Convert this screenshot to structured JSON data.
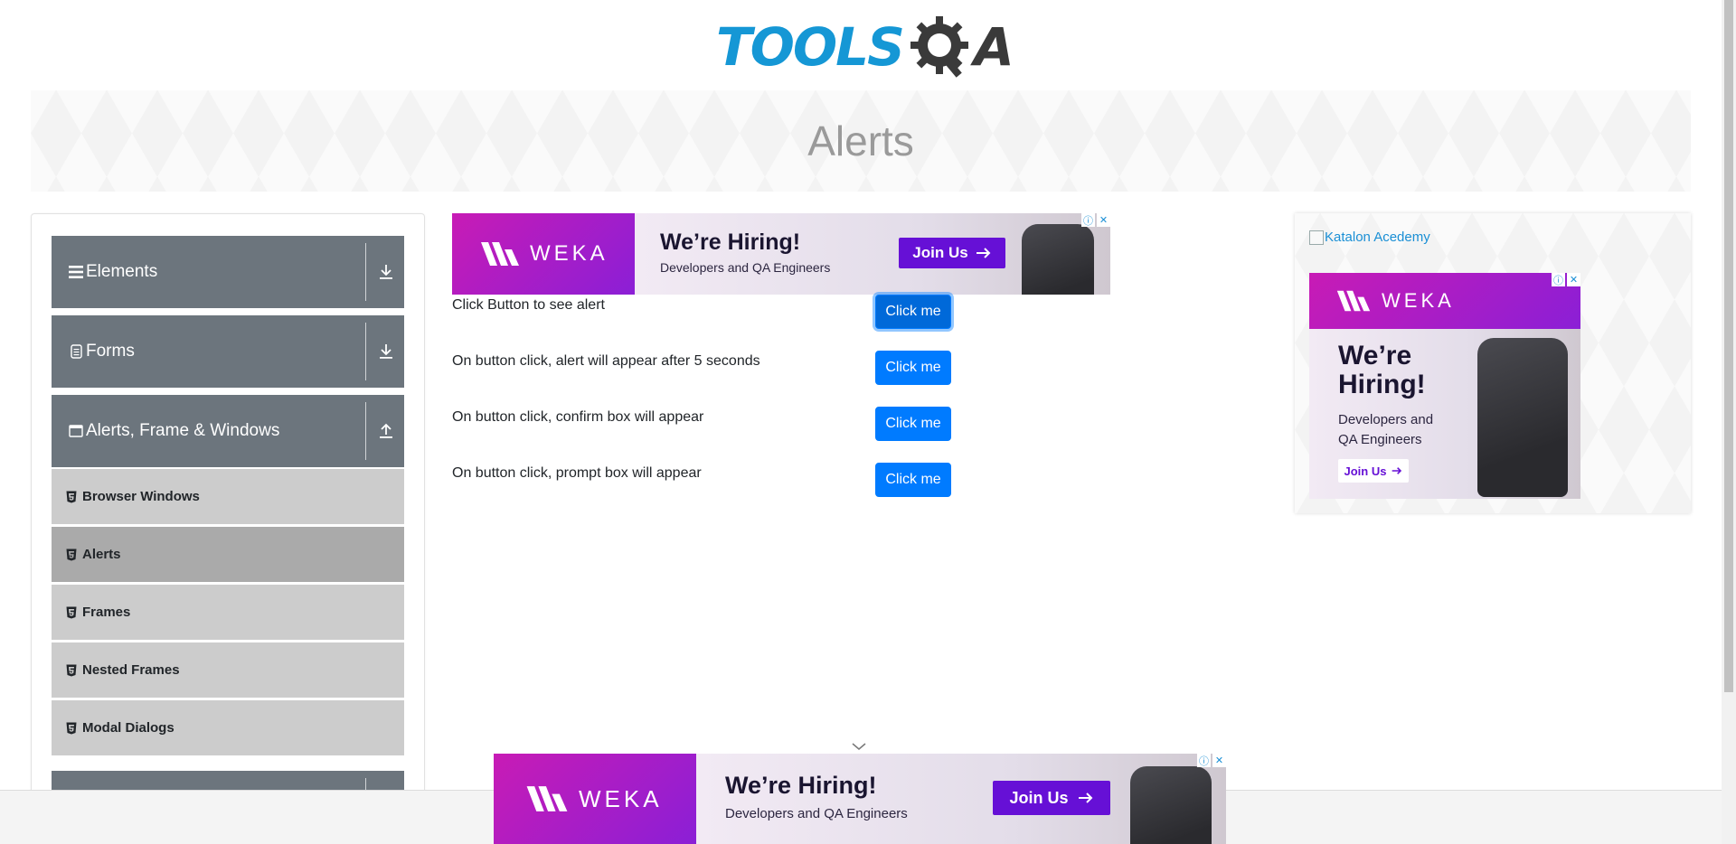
{
  "header": {
    "logo_tools": "TOOLS",
    "logo_a": "A",
    "logo_alt": "TOOLSQA"
  },
  "page": {
    "title": "Alerts"
  },
  "sidebar": {
    "groups": [
      {
        "label": "Elements",
        "icon": "hamburger-icon",
        "arrow": "download-icon",
        "expanded": false
      },
      {
        "label": "Forms",
        "icon": "document-icon",
        "arrow": "download-icon",
        "expanded": false
      },
      {
        "label": "Alerts, Frame & Windows",
        "icon": "window-icon",
        "arrow": "upload-icon",
        "expanded": true
      }
    ],
    "items": [
      {
        "label": "Browser Windows",
        "active": false
      },
      {
        "label": "Alerts",
        "active": true
      },
      {
        "label": "Frames",
        "active": false
      },
      {
        "label": "Nested Frames",
        "active": false
      },
      {
        "label": "Modal Dialogs",
        "active": false
      }
    ]
  },
  "ads": {
    "brand": "WEKA",
    "headline": "We’re Hiring!",
    "sub": "Developers and QA Engineers",
    "sub_line1": "Developers and",
    "sub_line2": "QA Engineers",
    "headline_line1": "We’re",
    "headline_line2": "Hiring!",
    "cta": "Join Us",
    "info_icon": "ⓘ",
    "close_icon": "✕"
  },
  "alerts": {
    "rows": [
      {
        "label": "Click Button to see alert",
        "button": "Click me",
        "focused": true
      },
      {
        "label": "On button click, alert will appear after 5 seconds",
        "button": "Click me",
        "focused": false
      },
      {
        "label": "On button click, confirm box will appear",
        "button": "Click me",
        "focused": false
      },
      {
        "label": "On button click, prompt box will appear",
        "button": "Click me",
        "focused": false
      }
    ]
  },
  "aside": {
    "link_text": "Katalon Acedemy"
  },
  "colors": {
    "primary_button": "#007bff",
    "sidebar_header": "#6c757d",
    "sidebar_item": "#cccccc",
    "sidebar_item_active": "#aaaaaa",
    "logo_blue": "#1597d5",
    "ad_purple": "#6610d6"
  }
}
